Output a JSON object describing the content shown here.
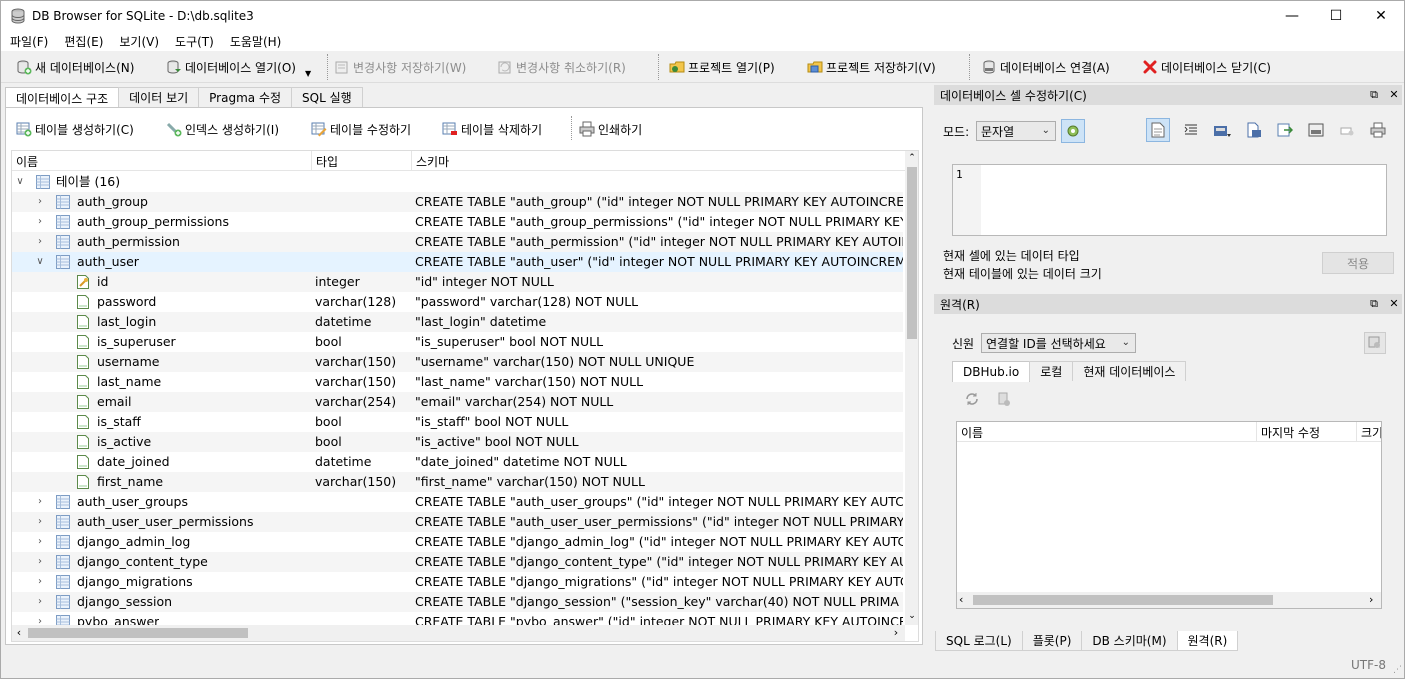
{
  "window": {
    "title": "DB Browser for SQLite - D:\\db.sqlite3",
    "minimize": "—",
    "maximize": "☐",
    "close": "✕"
  },
  "menu": [
    "파일(F)",
    "편집(E)",
    "보기(V)",
    "도구(T)",
    "도움말(H)"
  ],
  "toolbar": {
    "new_db": "새 데이터베이스(N)",
    "open_db": "데이터베이스 열기(O)",
    "write_changes": "변경사항 저장하기(W)",
    "revert_changes": "변경사항 취소하기(R)",
    "open_project": "프로젝트 열기(P)",
    "save_project": "프로젝트 저장하기(V)",
    "attach_db": "데이터베이스 연결(A)",
    "close_db": "데이터베이스 닫기(C)"
  },
  "tabs": [
    "데이터베이스 구조",
    "데이터 보기",
    "Pragma 수정",
    "SQL 실행"
  ],
  "structure_toolbar": {
    "create_table": "테이블 생성하기(C)",
    "create_index": "인덱스 생성하기(I)",
    "modify_table": "테이블 수정하기",
    "delete_table": "테이블 삭제하기",
    "print": "인쇄하기"
  },
  "tree": {
    "headers": {
      "name": "이름",
      "type": "타입",
      "schema": "스키마"
    },
    "root_label": "테이블 (16)",
    "tables_before": [
      {
        "name": "auth_group",
        "schema": "CREATE TABLE \"auth_group\" (\"id\" integer NOT NULL PRIMARY KEY AUTOINCREM"
      },
      {
        "name": "auth_group_permissions",
        "schema": "CREATE TABLE \"auth_group_permissions\" (\"id\" integer NOT NULL PRIMARY KEY"
      },
      {
        "name": "auth_permission",
        "schema": "CREATE TABLE \"auth_permission\" (\"id\" integer NOT NULL PRIMARY KEY AUTOIN"
      }
    ],
    "expanded_table": {
      "name": "auth_user",
      "schema": "CREATE TABLE \"auth_user\" (\"id\" integer NOT NULL PRIMARY KEY AUTOINCREM"
    },
    "fields": [
      {
        "name": "id",
        "type": "integer",
        "schema": "\"id\" integer NOT NULL",
        "key": true
      },
      {
        "name": "password",
        "type": "varchar(128)",
        "schema": "\"password\" varchar(128) NOT NULL"
      },
      {
        "name": "last_login",
        "type": "datetime",
        "schema": "\"last_login\" datetime"
      },
      {
        "name": "is_superuser",
        "type": "bool",
        "schema": "\"is_superuser\" bool NOT NULL"
      },
      {
        "name": "username",
        "type": "varchar(150)",
        "schema": "\"username\" varchar(150) NOT NULL UNIQUE"
      },
      {
        "name": "last_name",
        "type": "varchar(150)",
        "schema": "\"last_name\" varchar(150) NOT NULL"
      },
      {
        "name": "email",
        "type": "varchar(254)",
        "schema": "\"email\" varchar(254) NOT NULL"
      },
      {
        "name": "is_staff",
        "type": "bool",
        "schema": "\"is_staff\" bool NOT NULL"
      },
      {
        "name": "is_active",
        "type": "bool",
        "schema": "\"is_active\" bool NOT NULL"
      },
      {
        "name": "date_joined",
        "type": "datetime",
        "schema": "\"date_joined\" datetime NOT NULL"
      },
      {
        "name": "first_name",
        "type": "varchar(150)",
        "schema": "\"first_name\" varchar(150) NOT NULL"
      }
    ],
    "tables_after": [
      {
        "name": "auth_user_groups",
        "schema": "CREATE TABLE \"auth_user_groups\" (\"id\" integer NOT NULL PRIMARY KEY AUTC"
      },
      {
        "name": "auth_user_user_permissions",
        "schema": "CREATE TABLE \"auth_user_user_permissions\" (\"id\" integer NOT NULL PRIMARY"
      },
      {
        "name": "django_admin_log",
        "schema": "CREATE TABLE \"django_admin_log\" (\"id\" integer NOT NULL PRIMARY KEY AUTC"
      },
      {
        "name": "django_content_type",
        "schema": "CREATE TABLE \"django_content_type\" (\"id\" integer NOT NULL PRIMARY KEY AU"
      },
      {
        "name": "django_migrations",
        "schema": "CREATE TABLE \"django_migrations\" (\"id\" integer NOT NULL PRIMARY KEY AUTC"
      },
      {
        "name": "django_session",
        "schema": "CREATE TABLE \"django_session\" (\"session_key\" varchar(40) NOT NULL PRIMA"
      },
      {
        "name": "pybo_answer",
        "schema": "CREATE TABLE \"pybo_answer\" (\"id\" integer NOT NULL PRIMARY KEY AUTOINCR"
      }
    ]
  },
  "cell_edit": {
    "title": "데이터베이스 셀 수정하기(C)",
    "mode_label": "모드:",
    "mode_value": "문자열",
    "line_number": "1",
    "type_text": "현재 셀에 있는 데이터 타입",
    "size_text": "현재 테이블에 있는 데이터 크기",
    "apply": "적용"
  },
  "remote": {
    "title": "원격(R)",
    "identity_label": "신원",
    "identity_value": "연결할 ID를 선택하세요",
    "tabs": [
      "DBHub.io",
      "로컬",
      "현재 데이터베이스"
    ],
    "columns": [
      "이름",
      "마지막 수정",
      "크기"
    ]
  },
  "bottom_tabs": [
    "SQL 로그(L)",
    "플롯(P)",
    "DB 스키마(M)",
    "원격(R)"
  ],
  "status": {
    "encoding": "UTF-8"
  },
  "colors": {
    "selection": "#e5f3ff",
    "close_red": "#e02020"
  }
}
